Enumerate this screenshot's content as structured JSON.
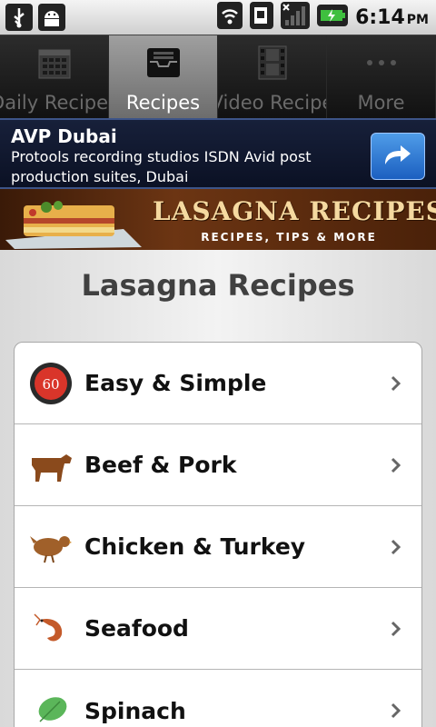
{
  "status_bar": {
    "time": "6:14",
    "ampm": "PM",
    "icons": [
      "usb-icon",
      "android-debug-icon",
      "wifi-icon",
      "sim-icon",
      "signal-icon",
      "battery-charging-icon"
    ]
  },
  "tabs": [
    {
      "label": "Daily Recipes",
      "icon": "calendar-icon",
      "selected": false
    },
    {
      "label": "Recipes",
      "icon": "inbox-tray-icon",
      "selected": true
    },
    {
      "label": "Video Recipe",
      "icon": "film-icon",
      "selected": false
    },
    {
      "label": "More",
      "icon": "more-dots-icon",
      "selected": false
    }
  ],
  "ad": {
    "title": "AVP Dubai",
    "text": "Protools recording studios ISDN Avid post production suites, Dubai",
    "button_icon": "share-arrow-icon"
  },
  "banner": {
    "title": "LASAGNA RECIPES",
    "subtitle": "RECIPES, TIPS & MORE"
  },
  "page": {
    "title": "Lasagna Recipes"
  },
  "categories": [
    {
      "label": "Easy & Simple",
      "icon": "timer-60-icon",
      "badge": "60"
    },
    {
      "label": "Beef & Pork",
      "icon": "cow-icon"
    },
    {
      "label": "Chicken & Turkey",
      "icon": "chicken-icon"
    },
    {
      "label": "Seafood",
      "icon": "shrimp-icon"
    },
    {
      "label": "Spinach",
      "icon": "spinach-leaf-icon"
    }
  ],
  "colors": {
    "tab_selected": "#8a8a8a",
    "ad_background": "#111a33",
    "ad_button": "#2e7bd8",
    "title_text": "#404040"
  }
}
